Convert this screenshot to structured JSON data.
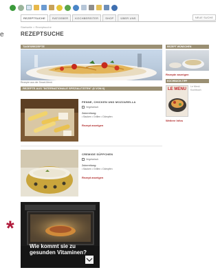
{
  "toolbar": {
    "icons": [
      "back-icon",
      "forward-icon",
      "page-icon",
      "bookmark-icon",
      "history-icon",
      "tools-icon",
      "favorite-icon",
      "refresh-icon",
      "globe-icon",
      "mail-icon",
      "print-icon",
      "folder-icon",
      "settings-icon",
      "help-icon"
    ]
  },
  "tabs": [
    {
      "label": "REZEPTSUCHE",
      "active": true
    },
    {
      "label": "RATGEBER",
      "active": false
    },
    {
      "label": "KOCHBEREITER",
      "active": false
    },
    {
      "label": "SHOP",
      "active": false
    },
    {
      "label": "ÜBER UNS",
      "active": false
    }
  ],
  "search_label": "NEUE SUCHE",
  "side_letter": "e",
  "breadcrumb": "Startseite > Rezeptsuche",
  "page_title": "REZEPTSUCHE",
  "sections": {
    "top": "TAGESREZEPTE",
    "recipes": "REZEPTE AUS \"INTERNATIONALE SPEZIALITÄTEN\" (6 VON 6)"
  },
  "hero_caption": "Rezepte aus der Smart-Menü",
  "right": {
    "box1_head": "REZEPT WÜNSCHEN",
    "box1_link": "Rezepte anzeigen",
    "box2_head": "KOCHBUCH-TIPP",
    "book_title": "LE MENU",
    "book_sub": "Le Menü Kochbuch",
    "book_link": "Weitere Infos"
  },
  "recipes": [
    {
      "title": "PENNE, CHICKEN UND MOZZARELLA",
      "veg": "Vegetarisch",
      "info_label": "Zubereitung:",
      "info": "• Backen • Grillen • Dämpfen",
      "link": "Rezept anzeigen"
    },
    {
      "title": "CREMIGE SÜPPCHEN",
      "veg": "Vegetarisch",
      "info_label": "Zubereitung:",
      "info": "• Backen • Grillen • Dämpfen",
      "link": "Rezept anzeigen"
    }
  ],
  "ad": {
    "line1": "Wie kommt sie zu",
    "line2": "gesunden Vitaminen?"
  },
  "colors": {
    "accent": "#9a8f73",
    "link": "#b02a2a",
    "asterisk": "#b0193a"
  }
}
